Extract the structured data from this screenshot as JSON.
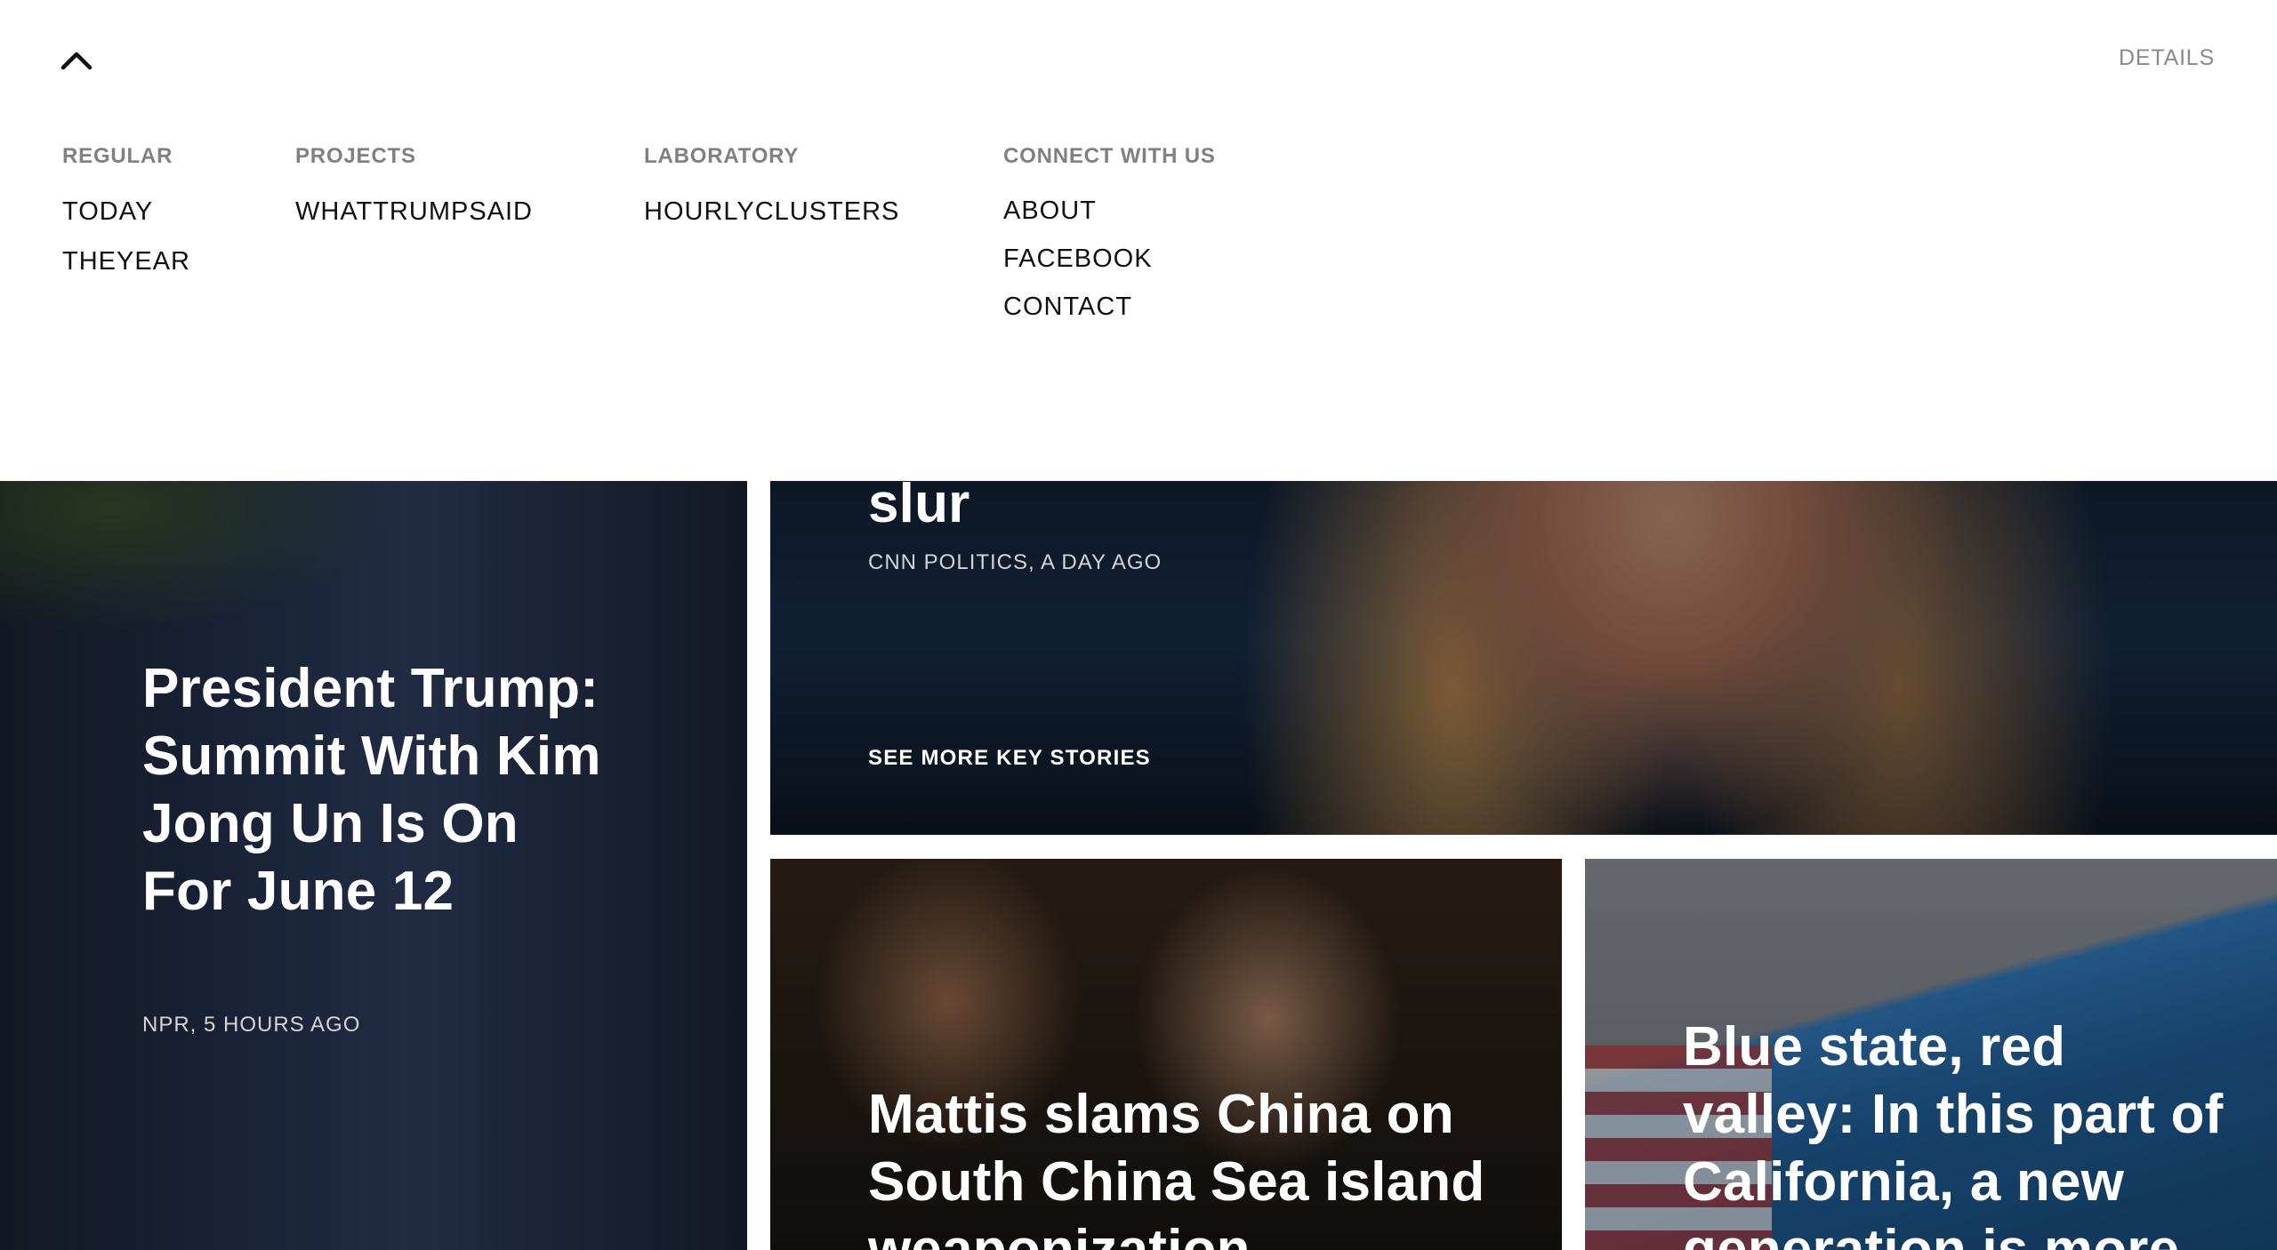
{
  "header": {
    "collapse_icon": "chevron-up-icon",
    "details_label": "DETAILS"
  },
  "menu": {
    "regular": {
      "heading": "REGULAR",
      "items": [
        "TODAY",
        "THEYEAR"
      ]
    },
    "projects": {
      "heading": "PROJECTS",
      "items": [
        "WHATTRUMPSAID"
      ]
    },
    "laboratory": {
      "heading": "LABORATORY",
      "items": [
        "HOURLYCLUSTERS"
      ]
    },
    "connect": {
      "heading": "CONNECT WITH US",
      "items": [
        "ABOUT",
        "FACEBOOK",
        "CONTACT"
      ]
    }
  },
  "stories": {
    "left": {
      "title": "President Trump: Summit With Kim Jong Un Is On For June 12",
      "meta": "NPR, 5 HOURS AGO"
    },
    "top": {
      "title_fragment": "slur",
      "meta": "CNN POLITICS, A DAY AGO",
      "see_more": "SEE MORE KEY STORIES"
    },
    "mid": {
      "title": "Mattis slams China on South China Sea island weaponization"
    },
    "right": {
      "title": "Blue state, red valley: In this part of California, a new generation is more"
    }
  }
}
